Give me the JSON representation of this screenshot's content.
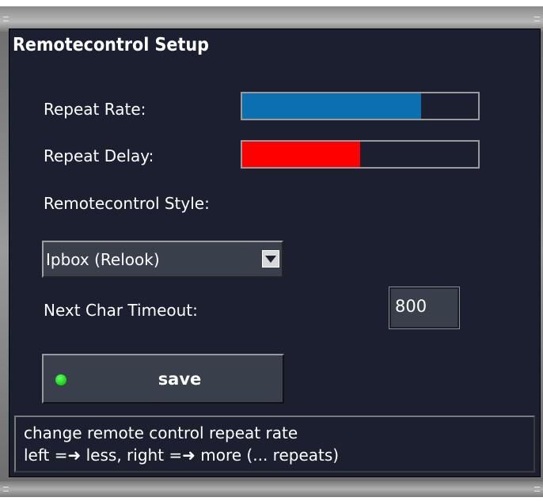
{
  "window": {
    "title": "Remotecontrol Setup"
  },
  "settings": {
    "repeat_rate": {
      "label": "Repeat Rate:",
      "level": 0.76,
      "color": "#0b6fb0"
    },
    "repeat_delay": {
      "label": "Repeat Delay:",
      "level": 0.5,
      "color": "#ff0000"
    },
    "style": {
      "label": "Remotecontrol Style:",
      "selected": "Ipbox (Relook)"
    },
    "next_char_timeout": {
      "label": "Next Char Timeout:",
      "value": "800"
    }
  },
  "save_button": {
    "label": "save",
    "led_color": "#19e019"
  },
  "help": {
    "line1": "change remote control repeat rate",
    "line2": "left =➜ less, right =➜ more (... repeats)"
  },
  "colors": {
    "panel_bg": "#1b1f2f",
    "control_bg": "#3a3f4c"
  }
}
